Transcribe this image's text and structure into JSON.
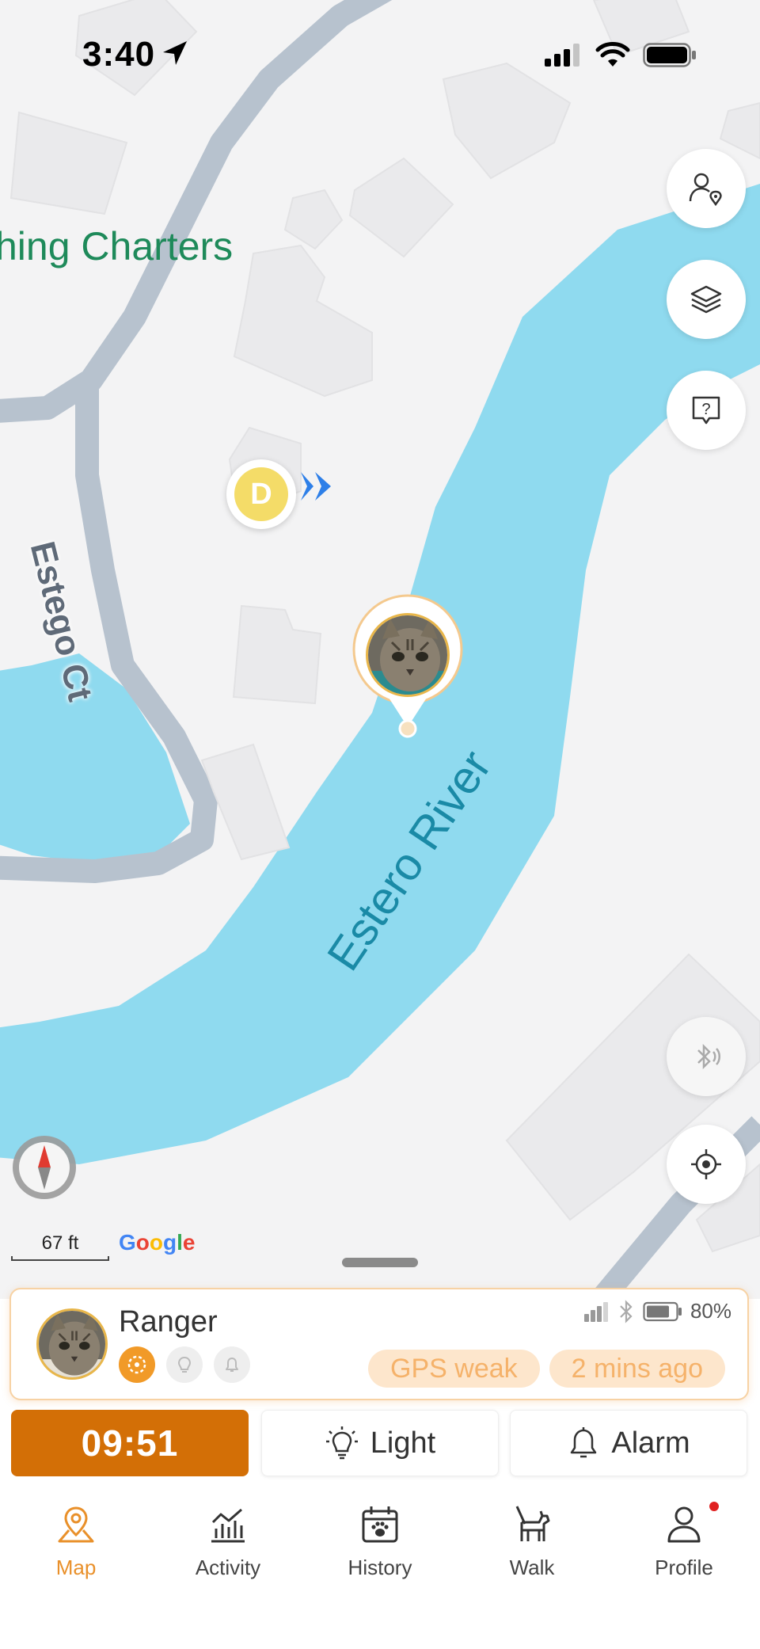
{
  "status_bar": {
    "time": "3:40",
    "battery_level": 1.0,
    "signal_bars": 3
  },
  "map": {
    "labels": {
      "place": "hing Charters",
      "road": "Estego Ct",
      "river": "Estero River"
    },
    "device_marker_letter": "D",
    "scale_label": "67 ft",
    "attribution": [
      "G",
      "o",
      "o",
      "g",
      "l",
      "e"
    ],
    "attribution_colors": [
      "#4285F4",
      "#EA4335",
      "#FBBC05",
      "#4285F4",
      "#34A853",
      "#EA4335"
    ],
    "colors": {
      "water": "#8fdaef",
      "land": "#f3f3f4",
      "road": "#b7c2ce",
      "building": "#eaeaec"
    },
    "icons": {
      "share": "people-location-icon",
      "layers": "layers-icon",
      "help": "help-chat-icon",
      "bluetooth": "bluetooth-sound-icon",
      "locate": "crosshair-icon",
      "compass": "compass-icon"
    }
  },
  "pet_card": {
    "name": "Ranger",
    "battery_percent": "80%",
    "battery_level": 0.8,
    "gps_status": "GPS weak",
    "last_update": "2 mins ago",
    "accent_color": "#f19a28"
  },
  "actions": {
    "timer": "09:51",
    "light_label": "Light",
    "alarm_label": "Alarm"
  },
  "tabs": [
    {
      "label": "Map",
      "icon": "map-pin-icon",
      "active": true
    },
    {
      "label": "Activity",
      "icon": "activity-chart-icon",
      "active": false
    },
    {
      "label": "History",
      "icon": "calendar-paw-icon",
      "active": false
    },
    {
      "label": "Walk",
      "icon": "dog-walk-icon",
      "active": false
    },
    {
      "label": "Profile",
      "icon": "person-icon",
      "active": false,
      "notification": true
    }
  ]
}
